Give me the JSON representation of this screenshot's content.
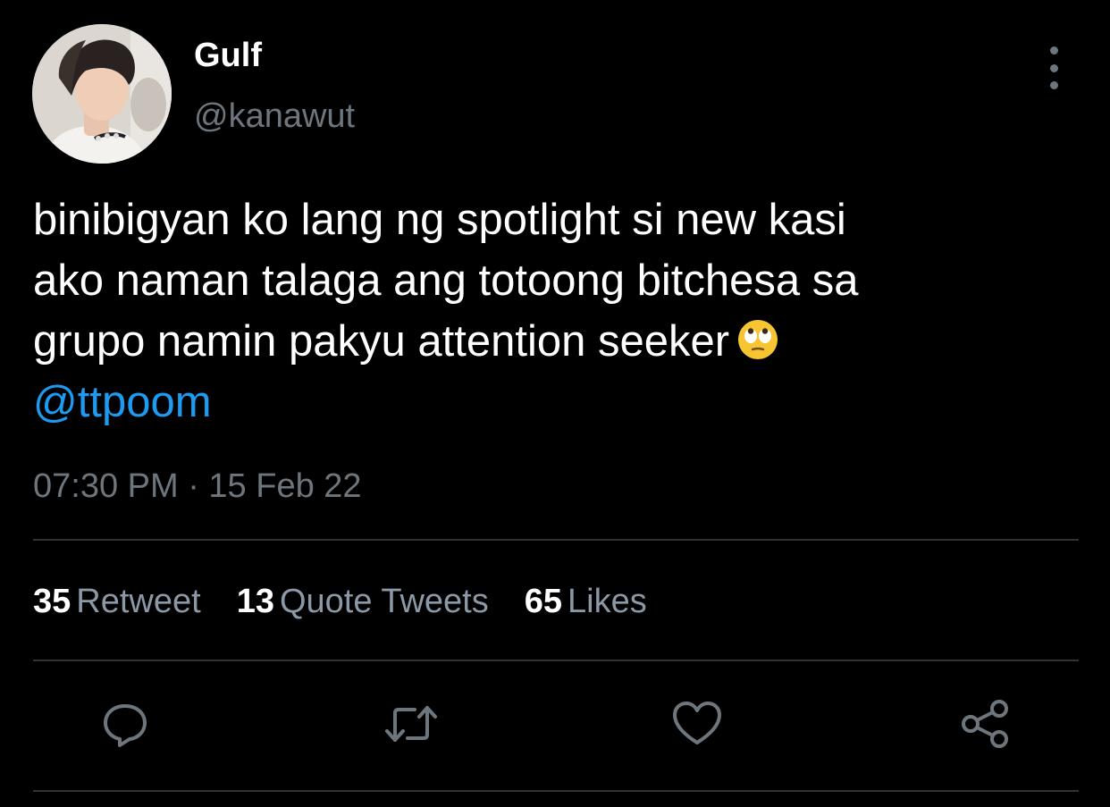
{
  "tweet": {
    "author": {
      "name": "Gulf",
      "handle": "@kanawut"
    },
    "text_lines": [
      "binibigyan ko lang ng spotlight si new kasi",
      "ako naman talaga ang totoong bitchesa sa",
      "grupo namin pakyu attention seeker"
    ],
    "emoji": "face-with-rolling-eyes-icon",
    "mention": "@ttpoom",
    "timestamp": "07:30 PM · 15 Feb 22"
  },
  "stats": {
    "retweets": {
      "count": "35",
      "label": "Retweet"
    },
    "quotes": {
      "count": "13",
      "label": "Quote Tweets"
    },
    "likes": {
      "count": "65",
      "label": "Likes"
    }
  },
  "actions": [
    "reply-icon",
    "retweet-icon",
    "like-icon",
    "share-icon"
  ],
  "colors": {
    "background": "#000000",
    "primary_text": "#ffffff",
    "secondary_text": "#6e767d",
    "stat_label": "#8b98a5",
    "link": "#1d9bf0",
    "divider": "#2f3336",
    "icon": "#6e767d"
  }
}
